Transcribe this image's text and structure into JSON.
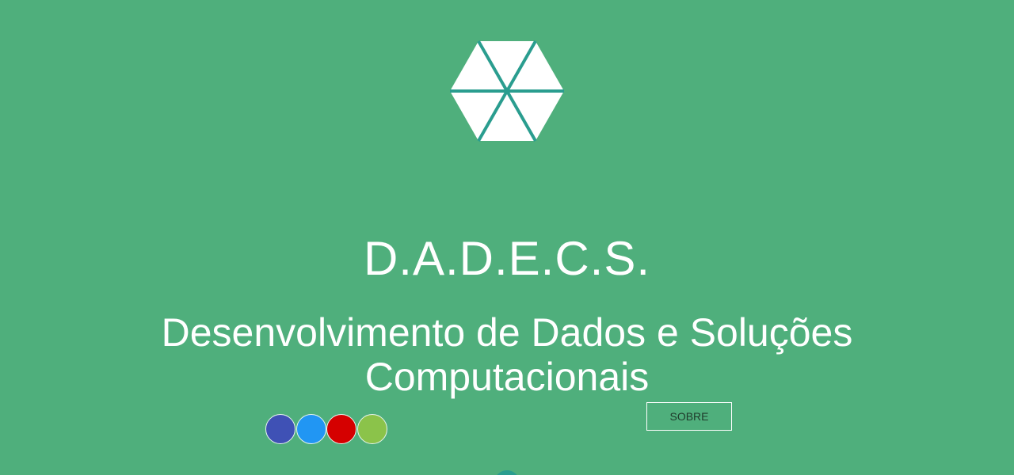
{
  "colors": {
    "background": "#4faf7c",
    "text": "#ffffff",
    "logo_fill": "#ffffff",
    "logo_lines": "#2a9d8f",
    "button_text": "#1f3b2b"
  },
  "logo": {
    "icon": "hexagon-triangles-icon"
  },
  "hero": {
    "title": "D.A.D.E.C.S.",
    "subtitle": "Desenvolvimento de Dados e Soluções Computacionais"
  },
  "theme_swatches": [
    {
      "color": "#3f51b5"
    },
    {
      "color": "#2196f3"
    },
    {
      "color": "#d50000"
    },
    {
      "color": "#8bc34a"
    }
  ],
  "actions": {
    "sobre_label": "SOBRE"
  }
}
